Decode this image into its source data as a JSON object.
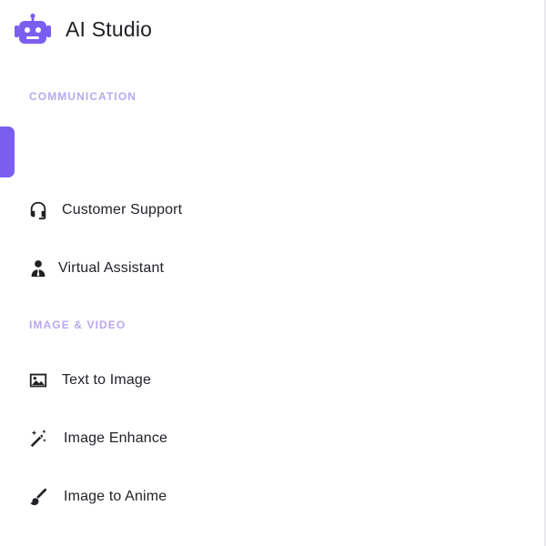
{
  "app": {
    "title": "AI Studio",
    "logo_icon": "robot-icon",
    "accent_color": "#7b5ef0",
    "section_title_color": "#b8a8ef"
  },
  "sections": [
    {
      "title": "COMMUNICATION",
      "items": [
        {
          "label": "Customer Support",
          "icon": "headset-icon"
        },
        {
          "label": "Virtual Assistant",
          "icon": "person-tie-icon"
        }
      ]
    },
    {
      "title": "IMAGE & VIDEO",
      "items": [
        {
          "label": "Text to Image",
          "icon": "image-icon"
        },
        {
          "label": "Image Enhance",
          "icon": "magic-wand-icon"
        },
        {
          "label": "Image to Anime",
          "icon": "brush-icon"
        }
      ]
    }
  ]
}
